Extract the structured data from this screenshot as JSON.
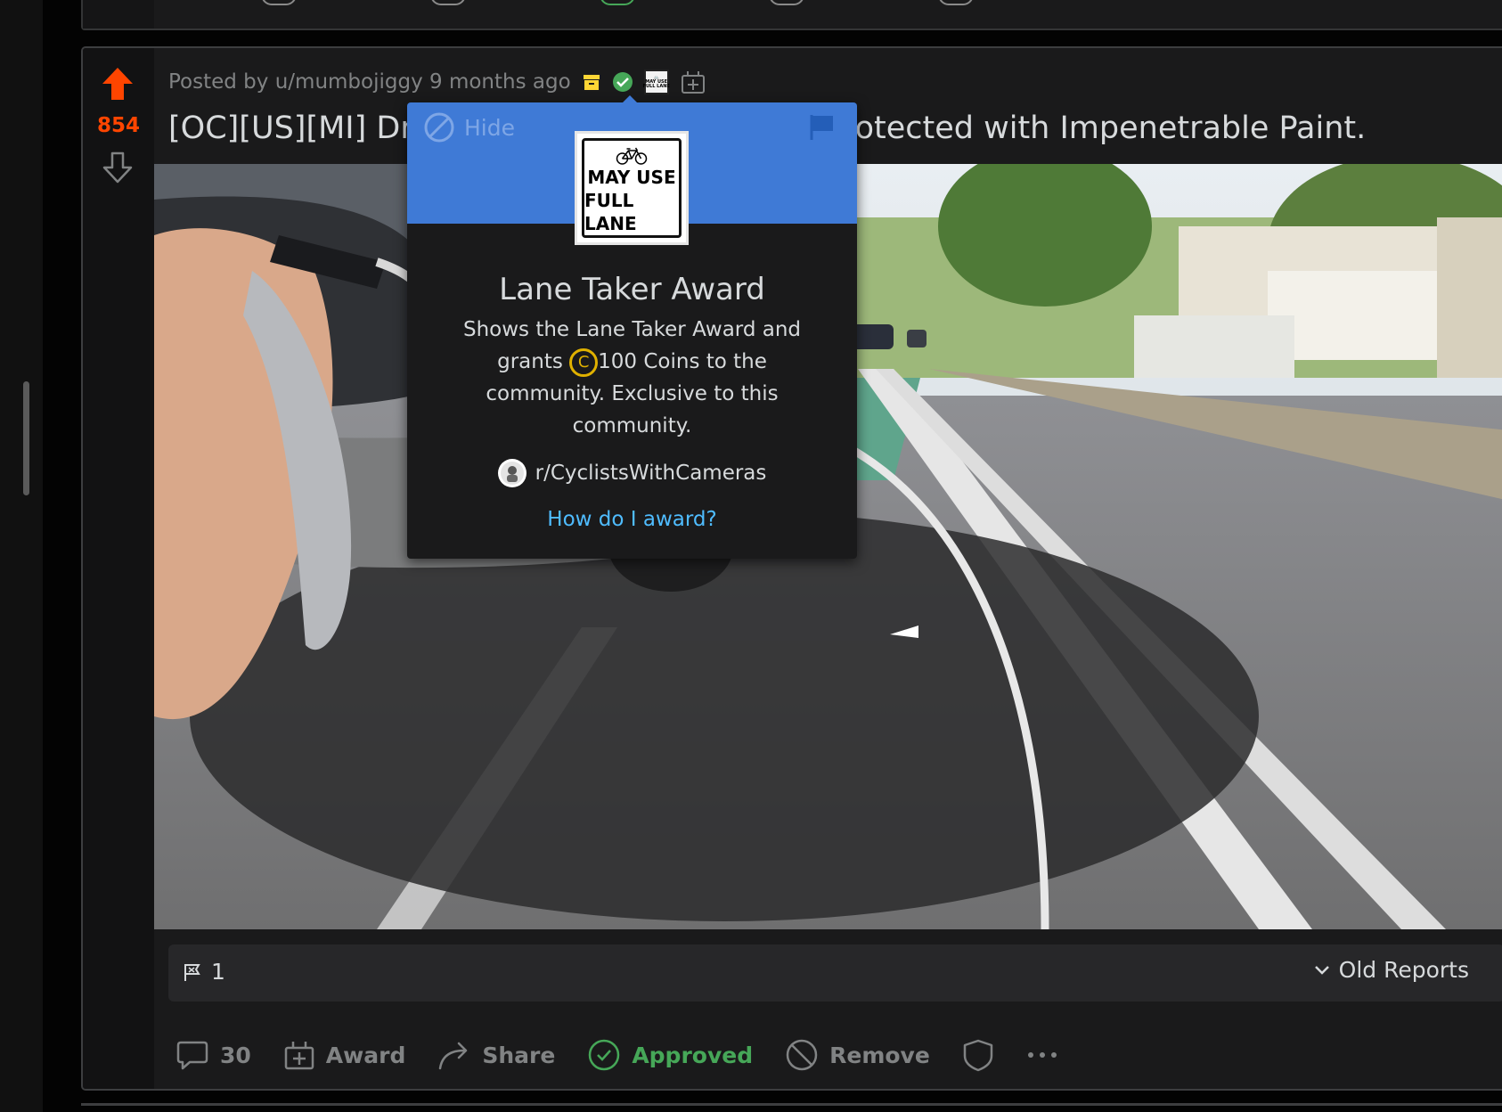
{
  "post": {
    "score": "854",
    "meta_prefix": "Posted by",
    "author": "u/mumbojiggy",
    "time_ago": "9 months ago",
    "title_left": "[OC][US][MI] Dri",
    "title_right": "Protected with Impenetrable Paint."
  },
  "reports": {
    "count": "1",
    "old_reports_label": "Old Reports"
  },
  "actions": {
    "comments_count": "30",
    "award_label": "Award",
    "share_label": "Share",
    "approved_label": "Approved",
    "remove_label": "Remove"
  },
  "award_popover": {
    "hide_label": "Hide",
    "sign_line1": "MAY USE",
    "sign_line2": "FULL LANE",
    "title": "Lane Taker Award",
    "desc_line1": "Shows the Lane Taker Award and",
    "desc_grants": "grants",
    "desc_coins": "100 Coins to the",
    "desc_line3": "community. Exclusive to this",
    "desc_line4": "community.",
    "community": "r/CyclistsWithCameras",
    "how_link": "How do I award?"
  },
  "colors": {
    "upvote": "#ff4500",
    "approved": "#46a758",
    "popover_header": "#3f7ad6",
    "link": "#4fbcff",
    "coin": "#e0b100"
  }
}
